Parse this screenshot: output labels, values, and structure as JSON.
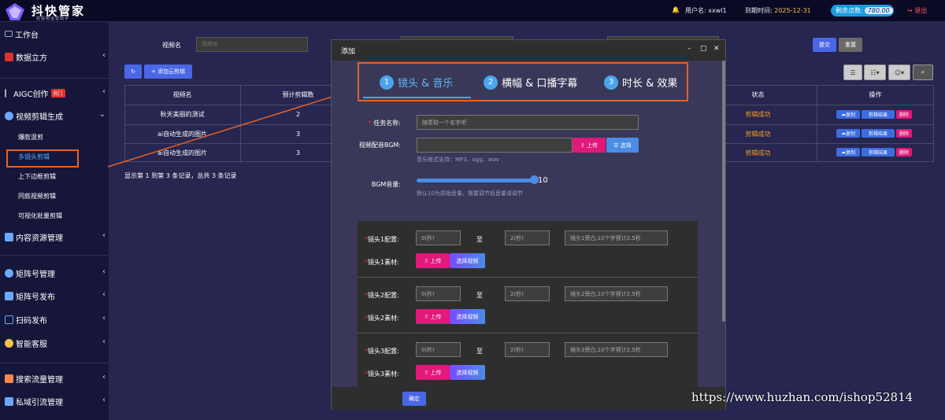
{
  "app": {
    "title": "抖快管家",
    "subtitle": "短视频运营助手"
  },
  "topbar": {
    "user": "用户名: xxwl1",
    "expire_label": "到期时间:",
    "expire_value": "2025-12-31",
    "points_label": "剩余点数:",
    "points_value": "780.00",
    "logout": "退出",
    "bell_icon": "bell-icon"
  },
  "sidebar": {
    "items": [
      {
        "label": "工作台"
      },
      {
        "label": "数据立方"
      },
      {
        "label": "AIGC创作",
        "badge": "热门"
      },
      {
        "label": "视频剪辑生成"
      },
      {
        "label": "内容资源管理"
      },
      {
        "label": "矩阵号管理"
      },
      {
        "label": "矩阵号发布"
      },
      {
        "label": "扫码发布"
      },
      {
        "label": "智能客服"
      },
      {
        "label": "搜索流量管理"
      },
      {
        "label": "私域引流管理"
      }
    ],
    "sub_items": [
      {
        "label": "爆款混剪"
      },
      {
        "label": "多镜头剪辑"
      },
      {
        "label": "上下边框剪辑"
      },
      {
        "label": "同款视频剪辑"
      },
      {
        "label": "可视化批量剪辑"
      }
    ]
  },
  "search": {
    "label": "视频名",
    "placeholder": "视频名",
    "submit": "提交",
    "reset": "重置"
  },
  "toolbar": {
    "add_cloud": "添加云剪辑"
  },
  "table": {
    "headers": [
      "视频名",
      "预计剪辑数",
      "状态",
      "操作"
    ],
    "rows": [
      {
        "name": "秋天美丽的测试",
        "count": "2",
        "status": "剪辑成功"
      },
      {
        "name": "ai自动生成的图片",
        "count": "3",
        "status": "剪辑成功"
      },
      {
        "name": "ai自动生成的图片",
        "count": "3",
        "status": "剪辑成功"
      }
    ],
    "actions": {
      "copy": "复制",
      "result": "剪辑结果",
      "delete": "删除"
    },
    "footer": "显示第 1 到第 3 条记录，总共 3 条记录"
  },
  "modal": {
    "title": "添加",
    "tabs": [
      {
        "num": "1",
        "label": "镜头 & 音乐"
      },
      {
        "num": "2",
        "label": "横幅 & 口播字幕"
      },
      {
        "num": "3",
        "label": "时长 & 效果"
      }
    ],
    "task_label": "任务名称:",
    "task_placeholder": "随意取一个名字吧",
    "bgm_label": "视频配音BGM:",
    "upload": "上传",
    "select": "选择",
    "bgm_hint": "音乐格式支持：MP3、ogg、wav",
    "volume_label": "BGM音量:",
    "volume_value": "10",
    "volume_fraction": 0.95,
    "volume_hint": "默认10为原始音量，需要调节低音量请调节",
    "to": "至",
    "select_video": "选择视频",
    "shots": [
      {
        "config_label": "镜头1配置:",
        "start": "0(秒)",
        "end": "2(秒)",
        "desc": "镜头1旁白,10个字预计2.5秒",
        "material_label": "镜头1素材:"
      },
      {
        "config_label": "镜头2配置:",
        "start": "0(秒)",
        "end": "2(秒)",
        "desc": "镜头2旁白,10个字预计2.5秒",
        "material_label": "镜头2素材:"
      },
      {
        "config_label": "镜头3配置:",
        "start": "0(秒)",
        "end": "2(秒)",
        "desc": "镜头3旁白,10个字预计2.5秒",
        "material_label": "镜头3素材:"
      }
    ],
    "ok": "确定"
  },
  "watermark": "https://www.huzhan.com/ishop52814",
  "colors": {
    "accent": "#4a67e6",
    "highlight": "#e4622a",
    "status": "#ff9f1a",
    "danger": "#e0197a"
  }
}
